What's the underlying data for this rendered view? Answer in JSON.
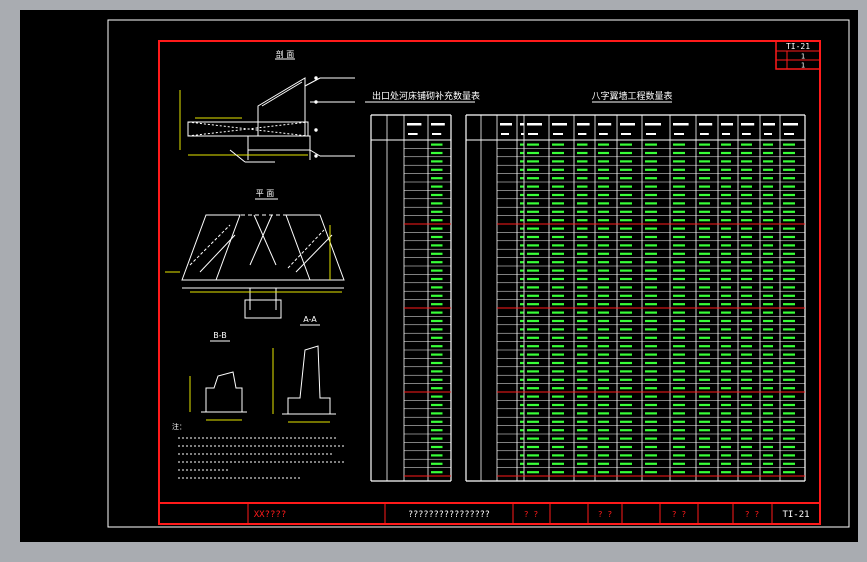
{
  "title_block": {
    "drawing_no": "TI-21",
    "sheet_a": "1",
    "sheet_b": "1",
    "org": "XX????",
    "drawing_name": "????????????????",
    "label_1": "? ?",
    "label_2": "? ?",
    "label_3": "? ?",
    "label_4": "? ?",
    "drawing_no_bottom": "TI-21"
  },
  "drawing": {
    "section_elevation": "剖 面",
    "section_plan": "平 面",
    "section_bb": "B-B",
    "section_aa": "A-A",
    "table_left_title": "出口处河床铺砌补充数量表",
    "table_right_title": "八字翼墙工程数量表",
    "notes_label": "注："
  },
  "colors": {
    "frame_red": "#ff1a1a",
    "line_white": "#ffffff",
    "data_green": "#38ff38",
    "dim_yellow": "#e6e600",
    "canvas_black": "#000000",
    "bg_grey": "#a9acb1"
  }
}
